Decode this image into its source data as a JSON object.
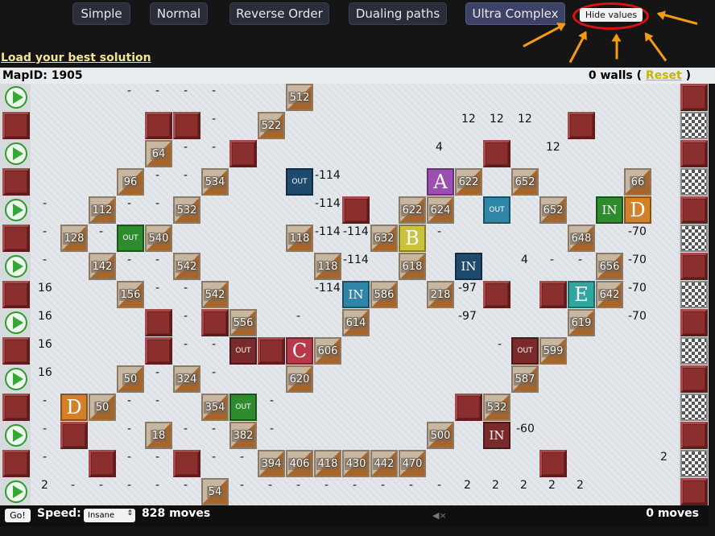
{
  "tabs": [
    {
      "label": "Simple",
      "active": false
    },
    {
      "label": "Normal",
      "active": false
    },
    {
      "label": "Reverse Order",
      "active": false
    },
    {
      "label": "Dualing paths",
      "active": false
    },
    {
      "label": "Ultra Complex",
      "active": true
    }
  ],
  "hide_values_label": "Hide values",
  "load_label": "Load your best solution",
  "map_id_label": "MapID: 1905",
  "walls": {
    "count_text": "0 walls",
    "open": "(",
    "reset": "Reset",
    "close": ")"
  },
  "footer": {
    "go": "Go!",
    "speed_label": "Speed:",
    "speed_value": "Insane",
    "best_moves": "828 moves",
    "current_moves": "0 moves"
  },
  "portals": {
    "in": "IN",
    "out": "OUT"
  },
  "checkpoints": {
    "A": "A",
    "B": "B",
    "C": "C",
    "D": "D",
    "E": "E"
  },
  "tile_values": [
    "512",
    "522",
    "64",
    "96",
    "534",
    "112",
    "532",
    "128",
    "540",
    "142",
    "542",
    "156",
    "542",
    "556",
    "50",
    "324",
    "50",
    "354",
    "18",
    "382",
    "54",
    "118",
    "118",
    "394",
    "406",
    "418",
    "430",
    "442",
    "470",
    "606",
    "620",
    "586",
    "614",
    "622",
    "624",
    "632",
    "618",
    "218",
    "500",
    "532",
    "622",
    "652",
    "652",
    "648",
    "656",
    "642",
    "619",
    "599",
    "587",
    "66"
  ],
  "values": {
    "row0": [
      "-",
      "-",
      "-",
      "-"
    ],
    "row1": [
      "-",
      "12",
      "12",
      "12"
    ],
    "row2": [
      "-",
      "-",
      "4",
      "12"
    ],
    "row3": [
      "-",
      "-",
      "-114"
    ],
    "row4": [
      "-",
      "-",
      "-",
      "-114"
    ],
    "row5": [
      "-",
      "-",
      "-114",
      "-114",
      "-",
      "-70"
    ],
    "row6": [
      "-",
      "-",
      "-",
      "-114",
      "4",
      "-",
      "-",
      "-70"
    ],
    "row7": [
      "16",
      "-",
      "-",
      "-114",
      "-97",
      "-70"
    ],
    "row8": [
      "16",
      "-",
      "-",
      "-97",
      "-70"
    ],
    "row9": [
      "16",
      "-",
      "-",
      "-"
    ],
    "row10": [
      "16",
      "-",
      "-"
    ],
    "row11": [
      "-",
      "-",
      "-",
      "-"
    ],
    "row12": [
      "-",
      "-",
      "-",
      "-",
      "-",
      "-60"
    ],
    "row13": [
      "-",
      "-",
      "-",
      "-",
      "-",
      "2"
    ],
    "row14": [
      "2",
      "-",
      "-",
      "-",
      "-",
      "-",
      "-",
      "-",
      "-",
      "-",
      "-",
      "-",
      "-",
      "-",
      "2",
      "2",
      "2",
      "2",
      "2"
    ]
  },
  "colors": {
    "wall": "#8a2e2e",
    "start_green": "#36a836",
    "accent": "#3d4266",
    "reset_link": "#c6b400",
    "arrow": "#f39c12",
    "highlight": "#e01010"
  }
}
